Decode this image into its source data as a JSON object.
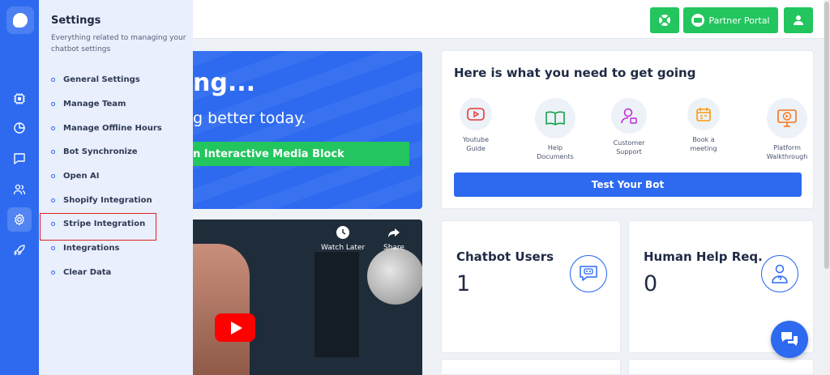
{
  "settings_panel": {
    "title": "Settings",
    "subtitle": "Everything related to managing your chatbot settings",
    "items": [
      {
        "label": "General Settings"
      },
      {
        "label": "Manage Team"
      },
      {
        "label": "Manage Offline Hours"
      },
      {
        "label": "Bot Synchronize"
      },
      {
        "label": "Open AI"
      },
      {
        "label": "Shopify Integration"
      },
      {
        "label": "Stripe Integration",
        "highlighted": true
      },
      {
        "label": "Integrations"
      },
      {
        "label": "Clear Data"
      }
    ]
  },
  "rail": {
    "icons": [
      "chatbot-logo-icon",
      "chip-icon",
      "clock-chart-icon",
      "message-icon",
      "users-icon",
      "gear-icon",
      "rocket-icon"
    ],
    "active": "gear-icon"
  },
  "topbar": {
    "partner_portal_label": "Partner Portal",
    "colors": {
      "green": "#22c55e"
    }
  },
  "hero": {
    "headline": "ng...",
    "subline": "g better today.",
    "cta_label": "n Interactive Media Block"
  },
  "video": {
    "watch_later_label": "Watch Later",
    "share_label": "Share"
  },
  "getting_started": {
    "title": "Here is what you need to get going",
    "items": [
      {
        "label": "Youtube Guide",
        "icon": "youtube-icon"
      },
      {
        "label": "Help Documents",
        "icon": "book-icon"
      },
      {
        "label": "Customer Support",
        "icon": "support-agent-icon"
      },
      {
        "label": "Book a meeting",
        "icon": "calendar-icon"
      },
      {
        "label": "Platform Walkthrough",
        "icon": "play-monitor-icon"
      }
    ],
    "test_bot_label": "Test Your Bot"
  },
  "stats": [
    {
      "title": "Chatbot Users",
      "value": "1",
      "icon": "bot-chat-icon"
    },
    {
      "title": "Human Help Req.",
      "value": "0",
      "icon": "user-question-icon"
    }
  ],
  "colors": {
    "brand": "#2d6af0",
    "highlight": "#e02020"
  }
}
